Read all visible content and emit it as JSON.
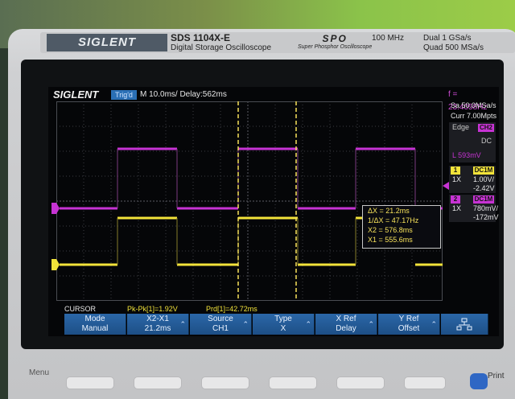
{
  "device": {
    "brand": "SIGLENT",
    "model": "SDS 1104X-E",
    "model_desc": "Digital Storage Oscilloscope",
    "spo_logo": "SPO",
    "spo_desc": "Super Phosphor Oscilloscope",
    "spec_bw": "100 MHz",
    "spec_dual": "Dual 1 GSa/s",
    "spec_quad": "Quad 500 MSa/s"
  },
  "status": {
    "logo": "SIGLENT",
    "trigger_state": "Trig'd",
    "timebase": "M 10.0ms/ Delay:562ms",
    "freq": "f = 23.4058Hz"
  },
  "right_panel": {
    "sample_rate": "Sa 50.0MSa/s",
    "curr_depth": "Curr 7.00Mpts",
    "edge_label": "Edge",
    "edge_channel": "CH2",
    "coupling": "DC",
    "level": "L  593mV",
    "ch1": {
      "num": "1",
      "badge": "DC1M",
      "probe": "1X",
      "scale": "1.00V/",
      "offset": "-2.42V"
    },
    "ch2": {
      "num": "2",
      "badge": "DC1M",
      "probe": "1X",
      "scale": "780mV/",
      "offset": "-172mV"
    }
  },
  "cursor_readout": {
    "dx": "ΔX = 21.2ms",
    "inv_dx": "1/ΔX = 47.17Hz",
    "x2": "X2 = 576.8ms",
    "x1": "X1 = 555.6ms"
  },
  "info_row": {
    "mode": "CURSOR",
    "pkpk": "Pk-Pk[1]=1.92V",
    "prd": "Prd[1]=42.72ms"
  },
  "softkeys": [
    {
      "l1": "Mode",
      "l2": "Manual",
      "arrow": ""
    },
    {
      "l1": "X2-X1",
      "l2": "21.2ms",
      "arrow": "⌃"
    },
    {
      "l1": "Source",
      "l2": "CH1",
      "arrow": "⌃"
    },
    {
      "l1": "Type",
      "l2": "X",
      "arrow": "⌃"
    },
    {
      "l1": "X Ref",
      "l2": "Delay",
      "arrow": "⌃"
    },
    {
      "l1": "Y Ref",
      "l2": "Offset",
      "arrow": "⌃"
    }
  ],
  "panel_labels": {
    "menu": "Menu",
    "print": "Print"
  },
  "colors": {
    "ch1": "#f2e33a",
    "ch2": "#c733d4",
    "cursor": "#f6e15a",
    "softkey": "#2b67a8"
  }
}
